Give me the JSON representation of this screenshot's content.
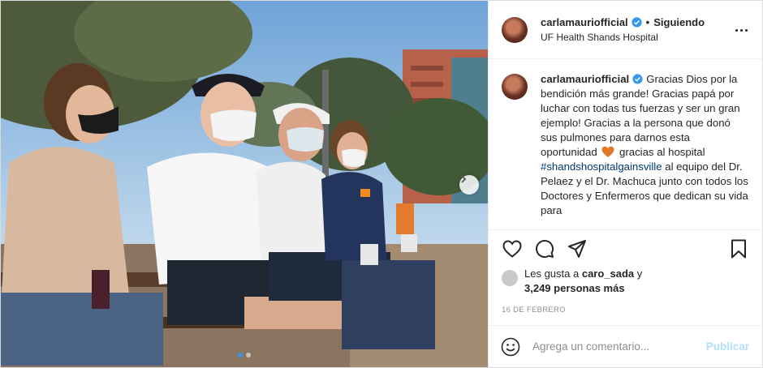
{
  "post": {
    "username": "carlamauriofficial",
    "follow_status": "Siguiendo",
    "separator": "•",
    "location": "UF Health Shands Hospital",
    "caption": {
      "text_1": "Gracias Dios por la bendición más grande! Gracias papá por luchar con todas tus fuerzas y ser un gran ejemplo! Gracias a la persona que donó sus pulmones para darnos esta oportunidad",
      "text_2": "gracias al hospital",
      "hashtag": "#shandshospitalgainsville",
      "text_3": "al equipo del Dr. Pelaez y el Dr. Machuca junto con todos los Doctores y Enfermeros que dedican su vida para"
    },
    "likes": {
      "prefix": "Les gusta a",
      "liker": "caro_sada",
      "conjunction": "y",
      "count_text": "3,249 personas más"
    },
    "date": "16 DE FEBRERO",
    "comment": {
      "placeholder": "Agrega un comentario...",
      "publish_label": "Publicar"
    },
    "carousel": {
      "slides": 2,
      "active_index": 1
    }
  },
  "colors": {
    "verified": "#3897f0",
    "hashtag": "#00376b",
    "publish_disabled": "#b2dffc",
    "active_dot": "#3d91e6",
    "heart_emoji": "#e0792b"
  },
  "icons": [
    "verified-badge-icon",
    "more-options-icon",
    "heart-icon",
    "comment-icon",
    "share-icon",
    "bookmark-icon",
    "emoji-icon",
    "chevron-right-icon"
  ]
}
